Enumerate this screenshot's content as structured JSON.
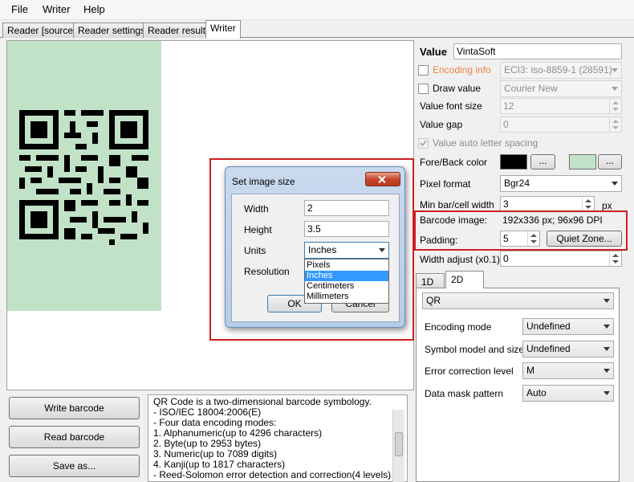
{
  "menu": {
    "file": "File",
    "writer": "Writer",
    "help": "Help"
  },
  "tabs": [
    "Reader [source]",
    "Reader settings",
    "Reader results",
    "Writer"
  ],
  "left_buttons": {
    "write": "Write barcode",
    "read": "Read barcode",
    "save": "Save as..."
  },
  "description": [
    "QR Code is a two-dimensional barcode symbology.",
    " - ISO/IEC 18004:2006(E)",
    " - Four data encoding modes:",
    "1. Alphanumeric(up to 4296 characters)",
    "2. Byte(up to 2953 bytes)",
    "3. Numeric(up to 7089 digits)",
    "4. Kanji(up to 1817 characters)",
    " - Reed-Solomon error detection and correction(4 levels)"
  ],
  "settings": {
    "value_label": "Value",
    "value": "VintaSoft",
    "encoding_info_label": "Encoding info",
    "encoding_info_value": "ECI3: iso-8859-1 (28591)",
    "draw_value_label": "Draw value",
    "font_value": "Courier New",
    "value_font_size_label": "Value font size",
    "value_font_size": "12",
    "value_gap_label": "Value gap",
    "value_gap": "0",
    "auto_spacing_label": "Value auto letter spacing",
    "fore_back_label": "Fore/Back color",
    "ellipsis": "...",
    "fore_color": "#000000",
    "back_color": "#c2e2c8",
    "pixel_format_label": "Pixel format",
    "pixel_format": "Bgr24",
    "min_bar_label": "Min bar/cell width",
    "min_bar": "3",
    "px": "px",
    "barcode_image_label": "Barcode image:",
    "barcode_image_value": "192x336 px; 96x96 DPI",
    "padding_label": "Padding:",
    "padding": "5",
    "quiet_zone": "Quiet Zone...",
    "width_adjust_label": "Width adjust (x0.1):",
    "width_adjust": "0"
  },
  "subtabs": [
    "1D",
    "2D"
  ],
  "twod": {
    "symbology": "QR",
    "encoding_mode_label": "Encoding mode",
    "encoding_mode": "Undefined",
    "symbol_model_label": "Symbol model and size",
    "symbol_model": "Undefined",
    "error_level_label": "Error correction level",
    "error_level": "M",
    "mask_label": "Data mask pattern",
    "mask": "Auto"
  },
  "dialog": {
    "title": "Set image size",
    "width_label": "Width",
    "width": "2",
    "height_label": "Height",
    "height": "3.5",
    "units_label": "Units",
    "units": "Inches",
    "resolution_label": "Resolution",
    "ok": "OK",
    "cancel": "Cancel",
    "unit_options": [
      "Pixels",
      "Inches",
      "Centimeters",
      "Millimeters"
    ],
    "selected_option": 1
  },
  "colors": {
    "accent_red": "#d01f1f",
    "selection": "#3399ff",
    "disabled_text": "#8d8d8d"
  }
}
